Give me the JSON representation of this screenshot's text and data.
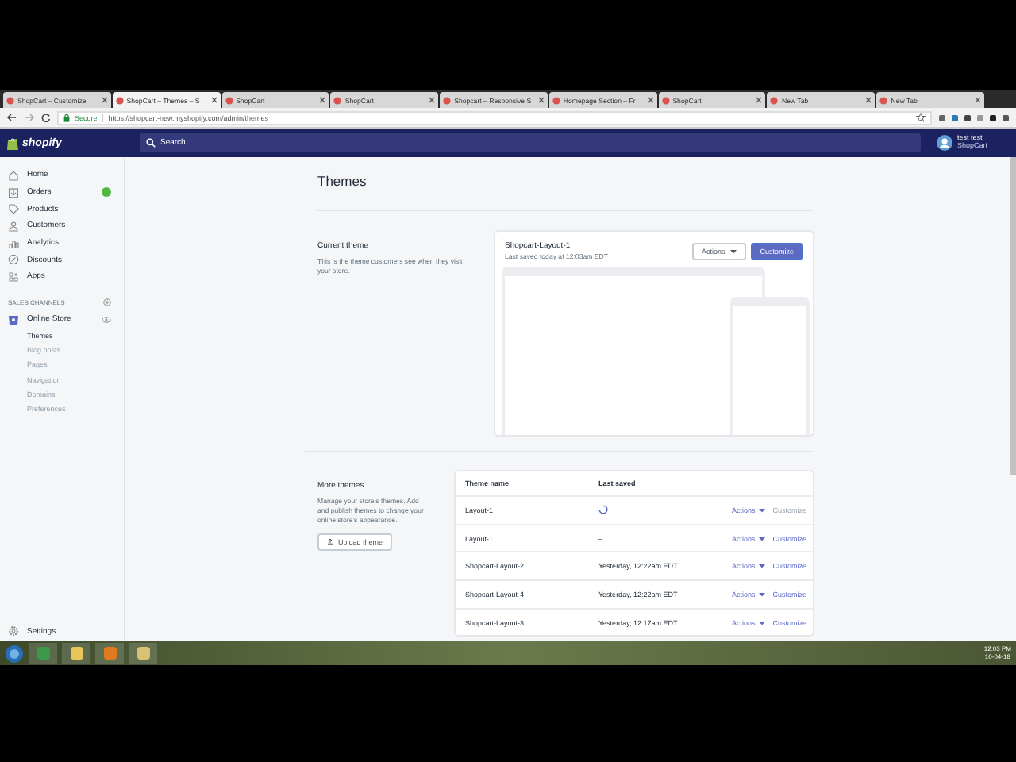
{
  "browser": {
    "tabs": [
      {
        "label": "ShopCart – Customize",
        "selected": false
      },
      {
        "label": "ShopCart – Themes – S",
        "selected": true
      },
      {
        "label": "ShopCart",
        "selected": false
      },
      {
        "label": "ShopCart",
        "selected": false
      },
      {
        "label": "Shopcart – Responsive S",
        "selected": false
      },
      {
        "label": "Homepage Section – Fr",
        "selected": false
      },
      {
        "label": "ShopCart",
        "selected": false
      },
      {
        "label": "New Tab",
        "selected": false
      },
      {
        "label": "New Tab",
        "selected": false
      }
    ],
    "address": {
      "secure_label": "Secure",
      "url": "https://shopcart-new.myshopify.com/admin/themes"
    }
  },
  "header": {
    "logo": "shopify",
    "search_placeholder": "Search",
    "user_name": "test test",
    "store_name": "ShopCart"
  },
  "sidebar": {
    "items": [
      {
        "label": "Home",
        "badge": false
      },
      {
        "label": "Orders",
        "badge": true
      },
      {
        "label": "Products",
        "badge": false
      },
      {
        "label": "Customers",
        "badge": false
      },
      {
        "label": "Analytics",
        "badge": false
      },
      {
        "label": "Discounts",
        "badge": false
      },
      {
        "label": "Apps",
        "badge": false
      }
    ],
    "channels_heading": "SALES CHANNELS",
    "channel": {
      "label": "Online Store",
      "children": [
        {
          "label": "Themes",
          "selected": true
        },
        {
          "label": "Blog posts",
          "selected": false
        },
        {
          "label": "Pages",
          "selected": false
        },
        {
          "label": "Navigation",
          "selected": false
        },
        {
          "label": "Domains",
          "selected": false
        },
        {
          "label": "Preferences",
          "selected": false
        }
      ]
    },
    "settings": "Settings"
  },
  "page": {
    "title": "Themes",
    "current_theme": {
      "heading": "Current theme",
      "description": "This is the theme customers see when they visit your store.",
      "theme_name": "Shopcart-Layout-1",
      "last_saved": "Last saved today at 12:03am EDT",
      "actions_button": "Actions",
      "customize_button": "Customize"
    },
    "more_themes": {
      "heading": "More themes",
      "description": "Manage your store's themes. Add and publish themes to change your online store's appearance.",
      "upload_button": "Upload theme",
      "table": {
        "columns": [
          "Theme name",
          "Last saved"
        ],
        "rows": [
          {
            "kind": "loading",
            "name": "Layout-1",
            "actions": "Actions",
            "customize": "Customize",
            "disabled": true
          },
          {
            "kind": "saved",
            "name": "Layout-1",
            "last_saved": "–",
            "actions": "Actions",
            "customize": "Customize",
            "disabled": false
          },
          {
            "kind": "saved",
            "name": "Shopcart-Layout-2",
            "last_saved": "Yesterday, 12:22am EDT",
            "actions": "Actions",
            "customize": "Customize",
            "disabled": false
          },
          {
            "kind": "saved",
            "name": "Shopcart-Layout-4",
            "last_saved": "Yesterday, 12:22am EDT",
            "actions": "Actions",
            "customize": "Customize",
            "disabled": false
          },
          {
            "kind": "saved",
            "name": "Shopcart-Layout-3",
            "last_saved": "Yesterday, 12:17am EDT",
            "actions": "Actions",
            "customize": "Customize",
            "disabled": false
          }
        ]
      }
    }
  },
  "taskbar": {
    "time": "12:03 PM",
    "date": "10-04-18"
  }
}
